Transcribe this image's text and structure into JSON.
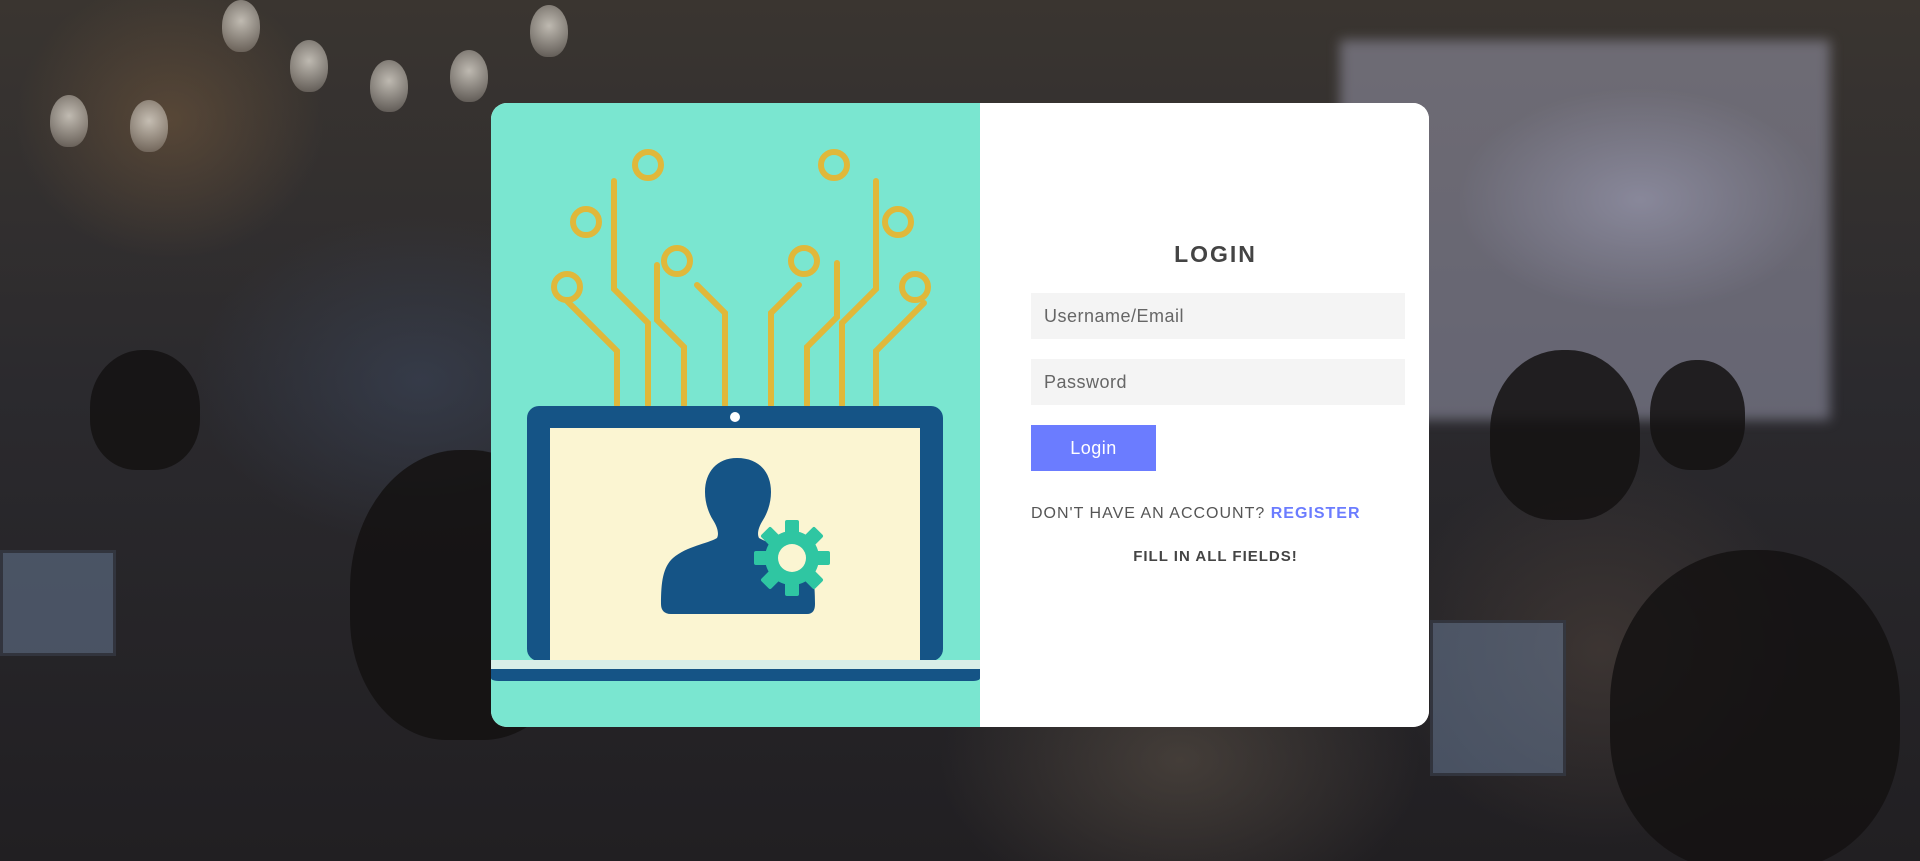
{
  "login": {
    "title": "LOGIN",
    "username_placeholder": "Username/Email",
    "password_placeholder": "Password",
    "submit_label": "Login",
    "no_account_text": "DON'T HAVE AN ACCOUNT?",
    "register_label": "REGISTER",
    "status_message": "FILL IN ALL FIELDS!"
  },
  "illustration": {
    "icon": "laptop-user-settings-illustration"
  },
  "colors": {
    "accent": "#6b7cff",
    "illustration_bg": "#7ae6d0",
    "circuit": "#e0b83a",
    "laptop": "#155486",
    "screen": "#fbf5d2",
    "gear": "#2fc6a2"
  }
}
